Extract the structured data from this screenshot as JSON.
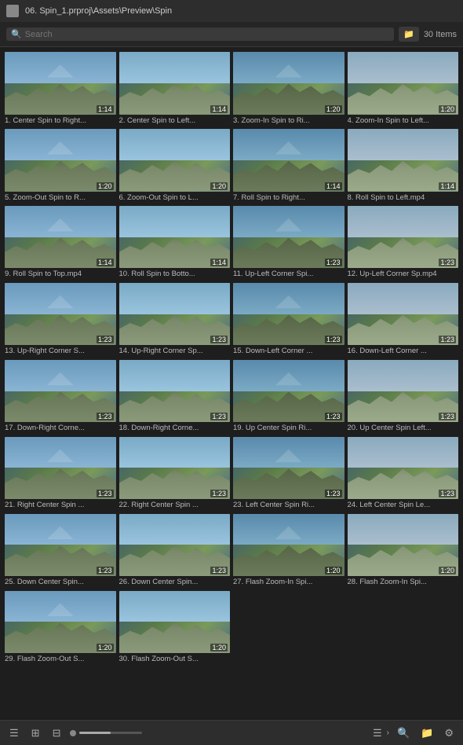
{
  "titleBar": {
    "path": "06. Spin_1.prproj\\Assets\\Preview\\Spin"
  },
  "search": {
    "placeholder": "Search",
    "itemCount": "30 Items"
  },
  "items": [
    {
      "id": 1,
      "label": "1. Center Spin to Right...",
      "duration": "1:14"
    },
    {
      "id": 2,
      "label": "2. Center Spin to Left...",
      "duration": "1:14"
    },
    {
      "id": 3,
      "label": "3. Zoom-In Spin to Ri...",
      "duration": "1:20"
    },
    {
      "id": 4,
      "label": "4. Zoom-In Spin to Left...",
      "duration": "1:20"
    },
    {
      "id": 5,
      "label": "5. Zoom-Out Spin to R...",
      "duration": "1:20"
    },
    {
      "id": 6,
      "label": "6. Zoom-Out Spin to L...",
      "duration": "1:20"
    },
    {
      "id": 7,
      "label": "7. Roll Spin to Right...",
      "duration": "1:14"
    },
    {
      "id": 8,
      "label": "8. Roll Spin to Left.mp4",
      "duration": "1:14"
    },
    {
      "id": 9,
      "label": "9. Roll Spin to Top.mp4",
      "duration": "1:14"
    },
    {
      "id": 10,
      "label": "10. Roll Spin to Botto...",
      "duration": "1:14"
    },
    {
      "id": 11,
      "label": "11. Up-Left Corner Spi...",
      "duration": "1:23"
    },
    {
      "id": 12,
      "label": "12. Up-Left Corner Sp.mp4",
      "duration": "1:23"
    },
    {
      "id": 13,
      "label": "13. Up-Right Corner S...",
      "duration": "1:23"
    },
    {
      "id": 14,
      "label": "14. Up-Right Corner Sp...",
      "duration": "1:23"
    },
    {
      "id": 15,
      "label": "15. Down-Left Corner ...",
      "duration": "1:23"
    },
    {
      "id": 16,
      "label": "16. Down-Left Corner ...",
      "duration": "1:23"
    },
    {
      "id": 17,
      "label": "17. Down-Right Corne...",
      "duration": "1:23"
    },
    {
      "id": 18,
      "label": "18. Down-Right Corne...",
      "duration": "1:23"
    },
    {
      "id": 19,
      "label": "19. Up Center Spin Ri...",
      "duration": "1:23"
    },
    {
      "id": 20,
      "label": "20. Up Center Spin Left...",
      "duration": "1:23"
    },
    {
      "id": 21,
      "label": "21. Right Center Spin ...",
      "duration": "1:23"
    },
    {
      "id": 22,
      "label": "22. Right Center Spin ...",
      "duration": "1:23"
    },
    {
      "id": 23,
      "label": "23. Left Center Spin Ri...",
      "duration": "1:23"
    },
    {
      "id": 24,
      "label": "24. Left Center Spin Le...",
      "duration": "1:23"
    },
    {
      "id": 25,
      "label": "25. Down Center Spin...",
      "duration": "1:23"
    },
    {
      "id": 26,
      "label": "26. Down Center Spin...",
      "duration": "1:23"
    },
    {
      "id": 27,
      "label": "27. Flash Zoom-In Spi...",
      "duration": "1:20"
    },
    {
      "id": 28,
      "label": "28. Flash Zoom-In Spi...",
      "duration": "1:20"
    },
    {
      "id": 29,
      "label": "29. Flash Zoom-Out S...",
      "duration": "1:20"
    },
    {
      "id": 30,
      "label": "30. Flash Zoom-Out S...",
      "duration": "1:20"
    }
  ],
  "bottomBar": {
    "listIcon": "☰",
    "gridIcon": "⊞",
    "nestedIcon": "⊟",
    "circleIcon": "○",
    "chevronIcon": "›",
    "searchIcon": "⌕",
    "folderIcon": "📁",
    "settingsIcon": "⚙"
  }
}
